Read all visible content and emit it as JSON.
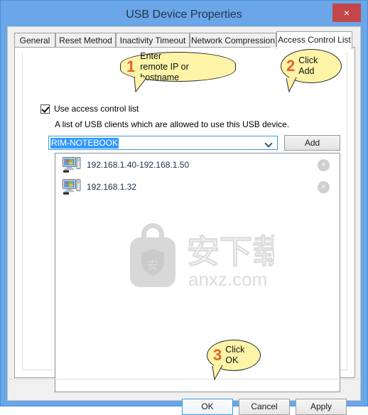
{
  "window": {
    "title": "USB Device Properties",
    "close_label": "×"
  },
  "tabs": [
    {
      "label": "General",
      "active": false
    },
    {
      "label": "Reset Method",
      "active": false
    },
    {
      "label": "Inactivity Timeout",
      "active": false
    },
    {
      "label": "Network Compression",
      "active": false
    },
    {
      "label": "Access Control List",
      "active": true
    }
  ],
  "acl_page": {
    "checkbox_label": "Use access control list",
    "checkbox_checked": true,
    "description": "A list of USB clients which are allowed to use this USB device.",
    "host_input": {
      "value": "RIM-NOTEBOOK",
      "placeholder": "Enter remote IP or hostname",
      "selected": true
    },
    "add_button": "Add",
    "entries": [
      {
        "label": "192.168.1.40-192.168.1.50",
        "icon": "computer-icon",
        "remove": "×"
      },
      {
        "label": "192.168.1.32",
        "icon": "computer-icon",
        "remove": "×"
      }
    ]
  },
  "watermark": {
    "shield_char": "安",
    "cn_text": "安下载",
    "domain": "anxz.com"
  },
  "footer": {
    "ok": "OK",
    "cancel": "Cancel",
    "apply": "Apply"
  },
  "callouts": [
    {
      "number": "1",
      "text": "Enter\nremote IP or hostname"
    },
    {
      "number": "2",
      "text": "Click\nAdd"
    },
    {
      "number": "3",
      "text": "Click\nOK"
    }
  ],
  "colors": {
    "titlebar": "#6aa6e8",
    "close": "#c3474a",
    "callout_fill": "#fdf4a8",
    "callout_number": "#e8622a",
    "selection": "#3399ff",
    "list_text": "#1a2f4a",
    "focus_border": "#3b9ae1"
  }
}
